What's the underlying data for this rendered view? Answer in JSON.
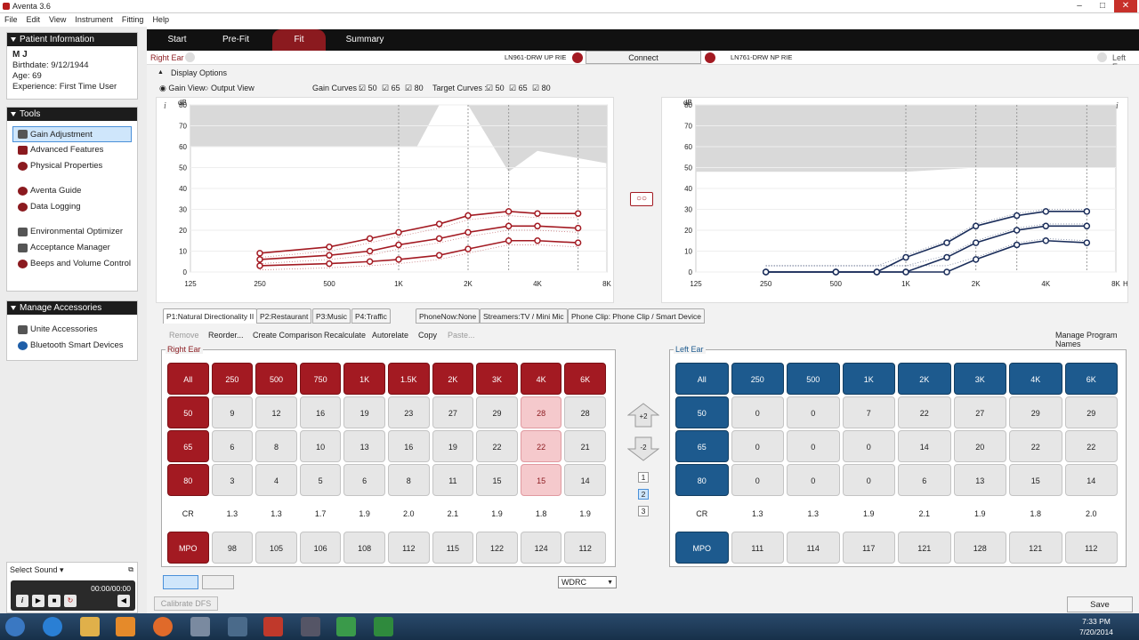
{
  "window": {
    "title": "Aventa 3.6"
  },
  "menu": [
    "File",
    "Edit",
    "View",
    "Instrument",
    "Fitting",
    "Help"
  ],
  "patient": {
    "header": "Patient Information",
    "name": "M J",
    "birthdate": "Birthdate: 9/12/1944",
    "age": "Age: 69",
    "experience": "Experience: First Time User"
  },
  "tools": {
    "header": "Tools",
    "items": [
      "Gain Adjustment",
      "Advanced Features",
      "Physical Properties",
      "Aventa Guide",
      "Data Logging",
      "Environmental Optimizer",
      "Acceptance Manager",
      "Beeps and Volume Control"
    ]
  },
  "accessories": {
    "header": "Manage Accessories",
    "items": [
      "Unite Accessories",
      "Bluetooth Smart Devices"
    ]
  },
  "sound": {
    "select": "Select Sound",
    "time": "00:00/00:00"
  },
  "tabs": [
    "Start",
    "Pre-Fit",
    "Fit",
    "Summary"
  ],
  "conn": {
    "right_ear": "Right Ear",
    "left_ear": "Left Ear",
    "right_model": "LN961-DRW UP RIE",
    "left_model": "LN761-DRW NP RIE",
    "connect": "Connect"
  },
  "display": {
    "title": "Display Options",
    "gain_view": "Gain View",
    "output_view": "Output View",
    "gain_curves": "Gain Curves :",
    "target_curves": "Target Curves :",
    "levels": [
      "50",
      "65",
      "80"
    ]
  },
  "charts": {
    "ylabel": "dB",
    "xunit": "Hz",
    "yticks": [
      "80",
      "70",
      "60",
      "50",
      "40",
      "30",
      "20",
      "10",
      "0"
    ],
    "xticks": [
      "125",
      "250",
      "500",
      "1K",
      "2K",
      "4K",
      "8K"
    ]
  },
  "programs": [
    "P1:Natural Directionality II",
    "P2:Restaurant",
    "P3:Music",
    "P4:Traffic",
    "PhoneNow:None",
    "Streamers:TV / Mini Mic",
    "Phone Clip: Phone Clip / Smart Device"
  ],
  "actions": [
    "Remove",
    "Reorder...",
    "Create Comparison",
    "Recalculate",
    "Autorelate",
    "Copy",
    "Paste...",
    "Manage Program Names"
  ],
  "right_table": {
    "label": "Right Ear",
    "all": "All",
    "freqs": [
      "250",
      "500",
      "750",
      "1K",
      "1.5K",
      "2K",
      "3K",
      "4K",
      "6K"
    ],
    "rows": [
      {
        "level": "50",
        "values": [
          "9",
          "12",
          "16",
          "19",
          "23",
          "27",
          "29",
          "28",
          "28"
        ]
      },
      {
        "level": "65",
        "values": [
          "6",
          "8",
          "10",
          "13",
          "16",
          "19",
          "22",
          "22",
          "21"
        ]
      },
      {
        "level": "80",
        "values": [
          "3",
          "4",
          "5",
          "6",
          "8",
          "11",
          "15",
          "15",
          "14"
        ]
      }
    ],
    "cr_label": "CR",
    "cr": [
      "1.3",
      "1.3",
      "1.7",
      "1.9",
      "2.0",
      "2.1",
      "1.9",
      "1.8",
      "1.9"
    ],
    "mpo_label": "MPO",
    "mpo": [
      "98",
      "105",
      "106",
      "108",
      "112",
      "115",
      "122",
      "124",
      "112"
    ]
  },
  "left_table": {
    "label": "Left Ear",
    "all": "All",
    "freqs": [
      "250",
      "500",
      "1K",
      "2K",
      "3K",
      "4K",
      "6K"
    ],
    "rows": [
      {
        "level": "50",
        "values": [
          "0",
          "0",
          "7",
          "22",
          "27",
          "29",
          "29"
        ]
      },
      {
        "level": "65",
        "values": [
          "0",
          "0",
          "0",
          "14",
          "20",
          "22",
          "22"
        ]
      },
      {
        "level": "80",
        "values": [
          "0",
          "0",
          "0",
          "6",
          "13",
          "15",
          "14"
        ]
      }
    ],
    "cr_label": "CR",
    "cr": [
      "1.3",
      "1.3",
      "1.9",
      "2.1",
      "1.9",
      "1.8",
      "2.0"
    ],
    "mpo_label": "MPO",
    "mpo": [
      "111",
      "114",
      "117",
      "121",
      "128",
      "121",
      "112"
    ]
  },
  "step": {
    "plus": "+2",
    "minus": "-2",
    "pages": [
      "1",
      "2",
      "3"
    ]
  },
  "compression": "WDRC",
  "calibrate": "Calibrate DFS",
  "save": "Save",
  "clock": {
    "time": "7:33 PM",
    "date": "7/20/2014"
  },
  "chart_data": [
    {
      "type": "line",
      "title": "Right Ear",
      "x": [
        "250",
        "500",
        "750",
        "1K",
        "1.5K",
        "2K",
        "3K",
        "4K",
        "6K"
      ],
      "ylim": [
        0,
        80
      ],
      "series": [
        {
          "name": "50",
          "values": [
            9,
            12,
            16,
            19,
            23,
            27,
            29,
            28,
            28
          ]
        },
        {
          "name": "65",
          "values": [
            6,
            8,
            10,
            13,
            16,
            19,
            22,
            22,
            21
          ]
        },
        {
          "name": "80",
          "values": [
            3,
            4,
            5,
            6,
            8,
            11,
            15,
            15,
            14
          ]
        }
      ]
    },
    {
      "type": "line",
      "title": "Left Ear",
      "x": [
        "250",
        "500",
        "750",
        "1K",
        "1.5K",
        "2K",
        "3K",
        "4K",
        "6K"
      ],
      "ylim": [
        0,
        80
      ],
      "series": [
        {
          "name": "50",
          "values": [
            0,
            0,
            0,
            7,
            14,
            22,
            27,
            29,
            29
          ]
        },
        {
          "name": "65",
          "values": [
            0,
            0,
            0,
            0,
            7,
            14,
            20,
            22,
            22
          ]
        },
        {
          "name": "80",
          "values": [
            0,
            0,
            0,
            0,
            0,
            6,
            13,
            15,
            14
          ]
        }
      ]
    }
  ]
}
